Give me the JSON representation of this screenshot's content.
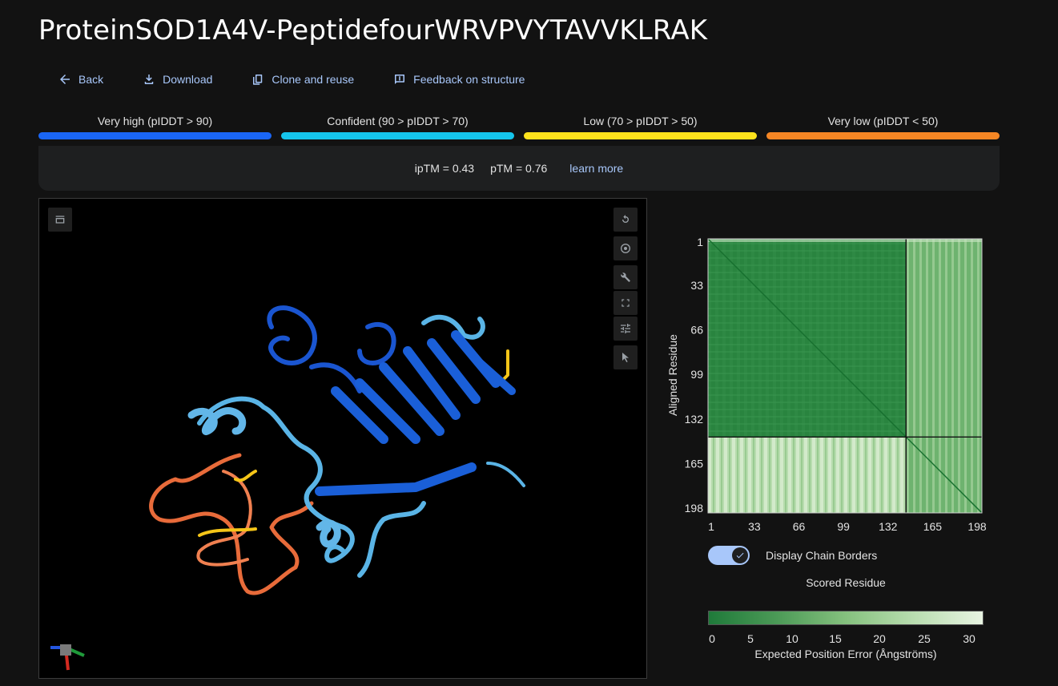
{
  "title": "ProteinSOD1A4V-PeptidefourWRVPVYTAVVKLRAK",
  "actions": {
    "back": "Back",
    "download": "Download",
    "clone": "Clone and reuse",
    "feedback": "Feedback on structure"
  },
  "legend": [
    {
      "label": "Very high (pIDDT > 90)",
      "color": "#1a66f5"
    },
    {
      "label": "Confident (90 > pIDDT > 70)",
      "color": "#15c5ec"
    },
    {
      "label": "Low (70 > pIDDT > 50)",
      "color": "#fde21c"
    },
    {
      "label": "Very low (pIDDT < 50)",
      "color": "#f58624"
    }
  ],
  "scores": {
    "iptm": "ipTM = 0.43",
    "ptm": "pTM = 0.76",
    "learn_more": "learn more"
  },
  "pae": {
    "ylabel": "Aligned Residue",
    "xlabel": "Scored Residue",
    "ticks": [
      "1",
      "33",
      "66",
      "99",
      "132",
      "165",
      "198"
    ],
    "toggle_label": "Display Chain Borders",
    "colorbar_ticks": [
      "0",
      "5",
      "10",
      "15",
      "20",
      "25",
      "30"
    ],
    "colorbar_label": "Expected Position Error (Ångströms)"
  }
}
